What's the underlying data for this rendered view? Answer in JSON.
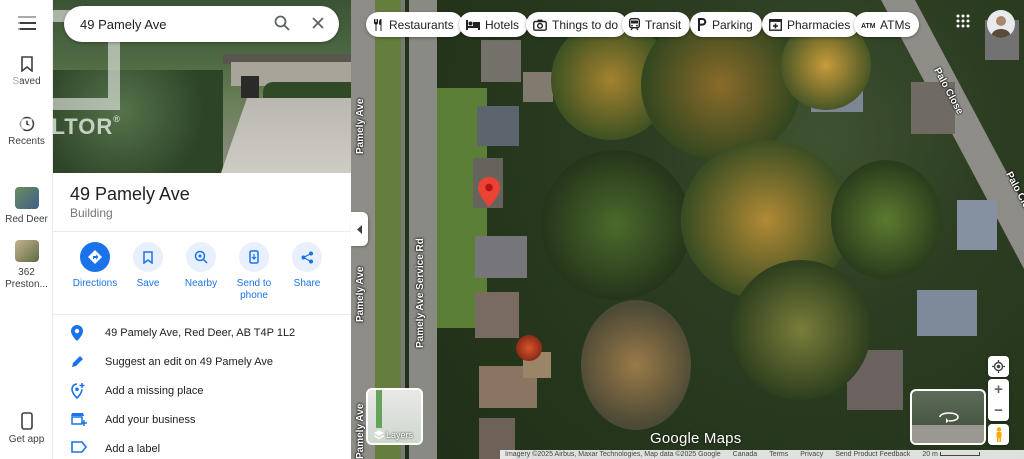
{
  "rail": {
    "saved_label": "Saved",
    "recents_label": "Recents",
    "recent_1_label": "Red Deer",
    "recent_2_label": "362 Preston...",
    "get_app_label": "Get app"
  },
  "search": {
    "value": "49 Pamely Ave"
  },
  "watermark": {
    "text": "REALTOR",
    "mark": "®"
  },
  "place": {
    "title": "49 Pamely Ave",
    "category": "Building"
  },
  "actions": [
    {
      "label": "Directions"
    },
    {
      "label": "Save"
    },
    {
      "label": "Nearby"
    },
    {
      "label": "Send to phone"
    },
    {
      "label": "Share"
    }
  ],
  "info": {
    "address": "49 Pamely Ave, Red Deer, AB T4P 1L2",
    "suggest_edit": "Suggest an edit on 49 Pamely Ave",
    "add_missing_place": "Add a missing place",
    "add_business": "Add your business",
    "add_label": "Add a label"
  },
  "chips": [
    {
      "label": "Restaurants",
      "icon": "fork-knife-icon"
    },
    {
      "label": "Hotels",
      "icon": "bed-icon"
    },
    {
      "label": "Things to do",
      "icon": "camera-icon"
    },
    {
      "label": "Transit",
      "icon": "train-icon"
    },
    {
      "label": "Parking",
      "icon": "parking-icon"
    },
    {
      "label": "Pharmacies",
      "icon": "pharmacy-icon"
    },
    {
      "label": "ATMs",
      "icon": "atm-icon"
    }
  ],
  "map": {
    "road_labels": {
      "pamely_ave_1": "Pamely Ave",
      "pamely_ave_2": "Pamely Ave",
      "pamely_ave_3": "Pamely Ave",
      "service_rd": "Pamely Ave Service Rd",
      "palo_close_1": "Palo Close",
      "palo_close_2": "Palo Close"
    },
    "layers_label": "Layers",
    "logo": "Google Maps",
    "pin_color": "#ea4335"
  },
  "footer": {
    "imagery": "Imagery ©2025 Airbus, Maxar Technologies, Map data ©2025 Google",
    "country": "Canada",
    "terms": "Terms",
    "privacy": "Privacy",
    "feedback": "Send Product Feedback",
    "scale": "20 m"
  },
  "colors": {
    "accent": "#1a73e8",
    "accent_light": "#e8f0fe"
  }
}
